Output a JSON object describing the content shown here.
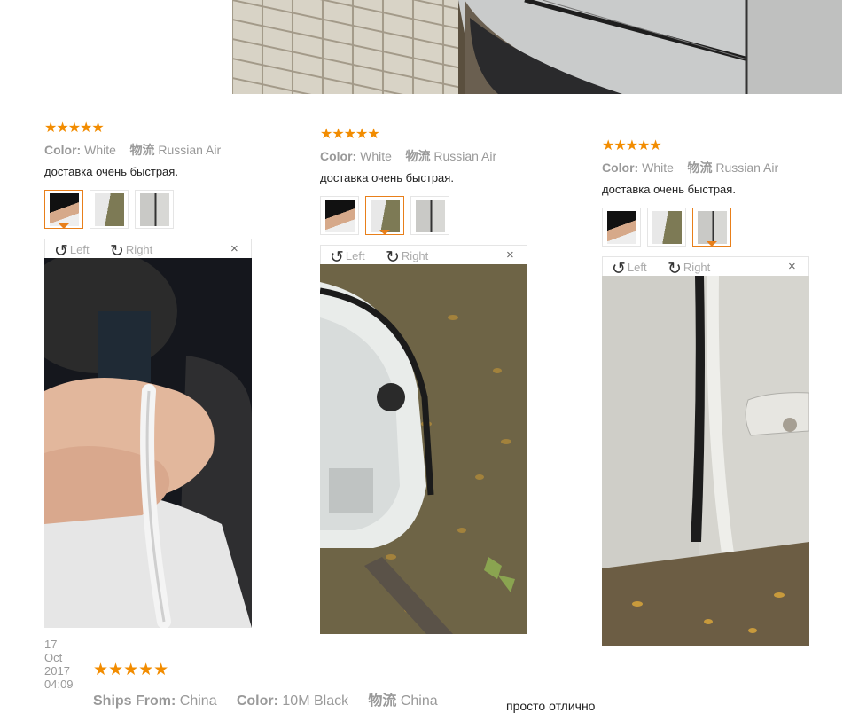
{
  "top_photo": {
    "alt": "car door with edge guard near brick wall"
  },
  "reviews": [
    {
      "rating": "★★★★★",
      "color_label": "Color:",
      "color_value": "White",
      "logistics_label": "物流",
      "logistics_value": "Russian Air",
      "comment": "доставка очень быстрая.",
      "selected_thumb": 0,
      "rotate_left": "Left",
      "rotate_right": "Right",
      "close": "×",
      "date": "17 Oct 2017 04:09"
    },
    {
      "rating": "★★★★★",
      "color_label": "Color:",
      "color_value": "White",
      "logistics_label": "物流",
      "logistics_value": "Russian Air",
      "comment": "доставка очень быстрая.",
      "selected_thumb": 1,
      "rotate_left": "Left",
      "rotate_right": "Right",
      "close": "×"
    },
    {
      "rating": "★★★★★",
      "color_label": "Color:",
      "color_value": "White",
      "logistics_label": "物流",
      "logistics_value": "Russian Air",
      "comment": "доставка очень быстрая.",
      "selected_thumb": 2,
      "rotate_left": "Left",
      "rotate_right": "Right",
      "close": "×"
    }
  ],
  "next_review": {
    "rating": "★★★★★",
    "ships_label": "Ships From:",
    "ships_value": "China",
    "color_label": "Color:",
    "color_value": "10M Black",
    "logistics_label": "物流",
    "logistics_value": "China",
    "comment": "просто отлично"
  },
  "colors": {
    "star": "#f28c00",
    "selected_border": "#e87f1a",
    "muted_text": "#999999"
  },
  "icons": {
    "rotate_left": "rotate-left-icon",
    "rotate_right": "rotate-right-icon",
    "close": "close-icon"
  }
}
